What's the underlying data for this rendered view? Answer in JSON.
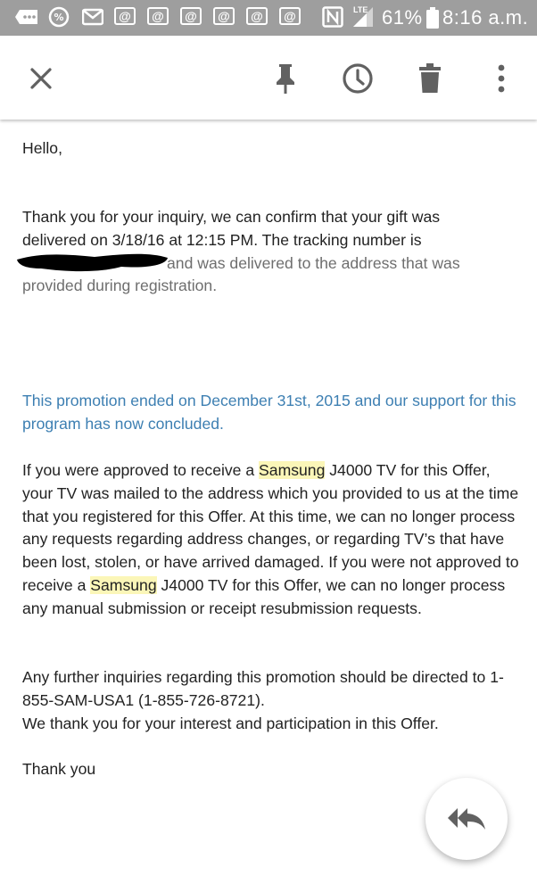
{
  "status_bar": {
    "battery_percent": "61%",
    "time": "8:16 a.m.",
    "network_label": "LTE",
    "icons": [
      "more-icon",
      "percent-icon",
      "gmail-icon",
      "email-icon",
      "email-icon",
      "email-icon",
      "email-icon",
      "email-icon",
      "email-icon",
      "nfc-icon",
      "signal-icon",
      "battery-icon"
    ]
  },
  "app_bar": {
    "actions": [
      "close-icon",
      "pin-icon",
      "snooze-icon",
      "delete-icon",
      "more-vert-icon"
    ]
  },
  "email": {
    "greeting": "Hello,",
    "para1_a": "Thank you for your inquiry, we can confirm that your gift was delivered on 3/18/16 at 12:15 PM. The tracking number is",
    "para1_b": "and was delivered to the address that was provided during registration.",
    "promo_notice": "This promotion ended on December 31st, 2015 and our support for this program has now concluded.",
    "para2_1": "If you were approved to receive a ",
    "brand": "Samsung",
    "para2_2": " J4000 TV for this Offer, your TV was mailed to the address which you provided to us at the time that you registered for this Offer. At this time, we can no longer process any requests regarding address changes, or regarding TV’s that have been lost, stolen, or have arrived damaged. If you were not approved to receive a ",
    "para2_3": " J4000 TV for this Offer, we can no longer process any manual submission or receipt resubmission requests.",
    "para3_1": "Any further inquiries regarding this promotion should be directed to 1-855-SAM-USA1 (1-855-726-8721).",
    "para3_2": "We thank you for your interest and participation in this Offer.",
    "closing": "Thank you"
  },
  "fab": {
    "icon": "reply-all-icon"
  },
  "colors": {
    "status_bar": "#9e9e9e",
    "link_blue": "#3d7fb2",
    "highlight": "#fbf6b8",
    "icon_gray": "#616161"
  }
}
